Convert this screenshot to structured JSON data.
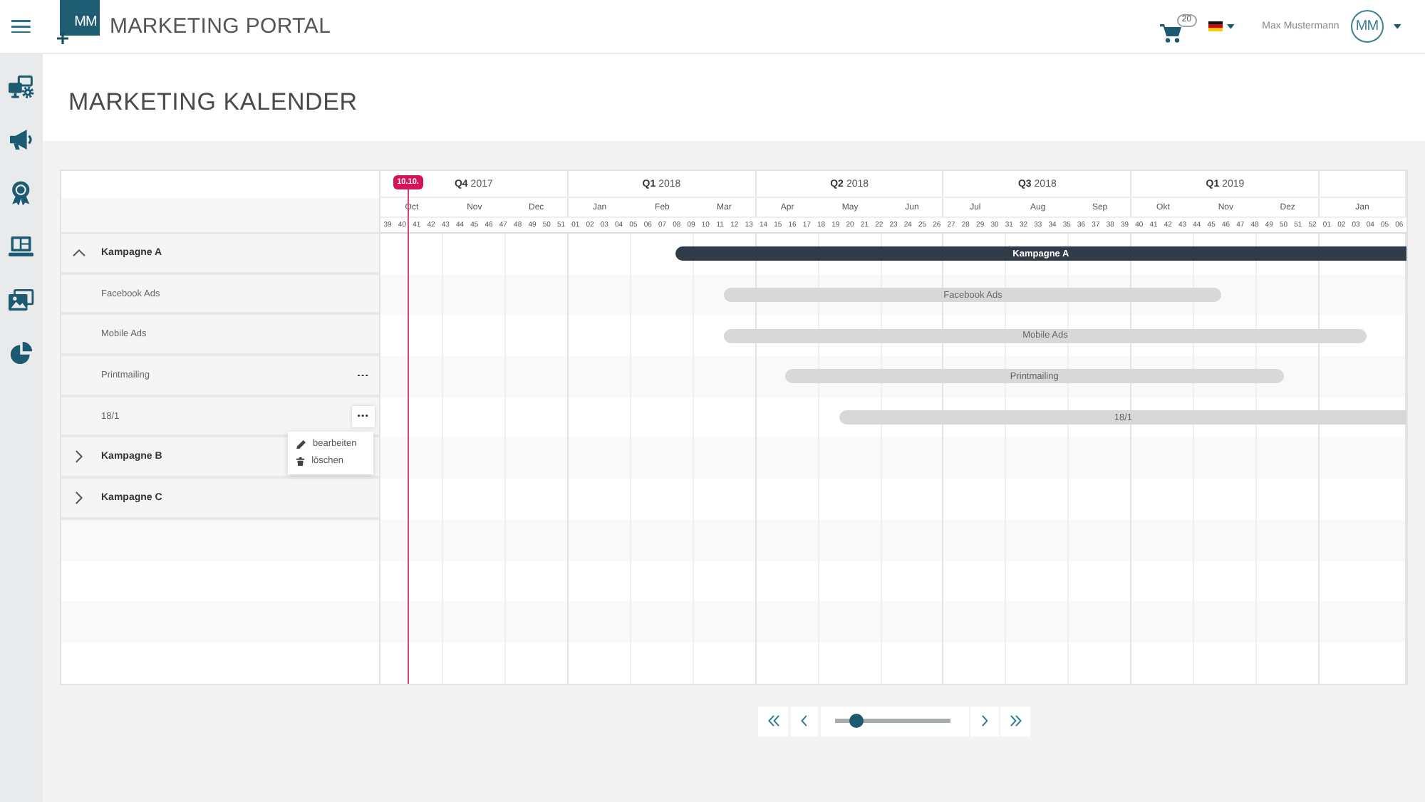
{
  "header": {
    "logo": "MM",
    "title": "MARKETING PORTAL",
    "cart_badge": "20",
    "user_name": "Max Mustermann",
    "avatar": "MM"
  },
  "page_title": "MARKETING KALENDER",
  "calendar": {
    "today": {
      "label": "10.10."
    },
    "quarters": [
      {
        "label": "**Q4** 2017",
        "months": [
          "Oct",
          "Nov",
          "Dec"
        ],
        "weeks": [
          "39",
          "40",
          "41",
          "42",
          "43",
          "44",
          "45",
          "46",
          "47",
          "48",
          "49",
          "50",
          "51"
        ]
      },
      {
        "label": "**Q1** 2018",
        "months": [
          "Jan",
          "Feb",
          "Mar"
        ],
        "weeks": [
          "01",
          "02",
          "03",
          "04",
          "05",
          "06",
          "07",
          "08",
          "09",
          "10",
          "11",
          "12",
          "13"
        ]
      },
      {
        "label": "**Q2** 2018",
        "months": [
          "Apr",
          "May",
          "Jun"
        ],
        "weeks": [
          "14",
          "15",
          "16",
          "17",
          "18",
          "19",
          "20",
          "21",
          "22",
          "23",
          "24",
          "25",
          "26"
        ]
      },
      {
        "label": "**Q3** 2018",
        "months": [
          "Jul",
          "Aug",
          "Sep"
        ],
        "weeks": [
          "27",
          "28",
          "29",
          "30",
          "31",
          "32",
          "33",
          "34",
          "35",
          "36",
          "37",
          "38",
          "39"
        ]
      },
      {
        "label": "**Q1** 2019",
        "months": [
          "Okt",
          "Nov",
          "Dez"
        ],
        "weeks": [
          "40",
          "41",
          "42",
          "43",
          "44",
          "45",
          "46",
          "47",
          "48",
          "49",
          "50",
          "51",
          "52"
        ]
      },
      {
        "months": [
          "Jan"
        ],
        "weeks": [
          "01",
          "02",
          "03",
          "04",
          "05",
          "06"
        ]
      }
    ],
    "rows": [
      {
        "name": "Kampagne A",
        "expanded": true,
        "bar": {
          "label": "Kampagne A"
        },
        "children": [
          {
            "name": "Facebook Ads",
            "show_actions": false,
            "menu_open": false,
            "bar": {
              "label": "Facebook Ads"
            }
          },
          {
            "name": "Mobile Ads",
            "show_actions": false,
            "menu_open": false,
            "bar": {
              "label": "Mobile Ads"
            }
          },
          {
            "name": "Printmailing",
            "show_actions": true,
            "menu_open": false,
            "bar": {
              "label": "Printmailing"
            }
          },
          {
            "name": "18/1",
            "show_actions": true,
            "menu_open": true,
            "bar": {
              "label": "18/1"
            }
          }
        ]
      },
      {
        "name": "Kampagne B",
        "expanded": false
      },
      {
        "name": "Kampagne C",
        "expanded": false
      }
    ],
    "row_menu": {
      "items": [
        {
          "kind": "edit",
          "label": "bearbeiten"
        },
        {
          "kind": "delete",
          "label": "löschen"
        }
      ]
    }
  },
  "timeline_controls": {
    "slider": {
      "level": 0.15
    }
  }
}
